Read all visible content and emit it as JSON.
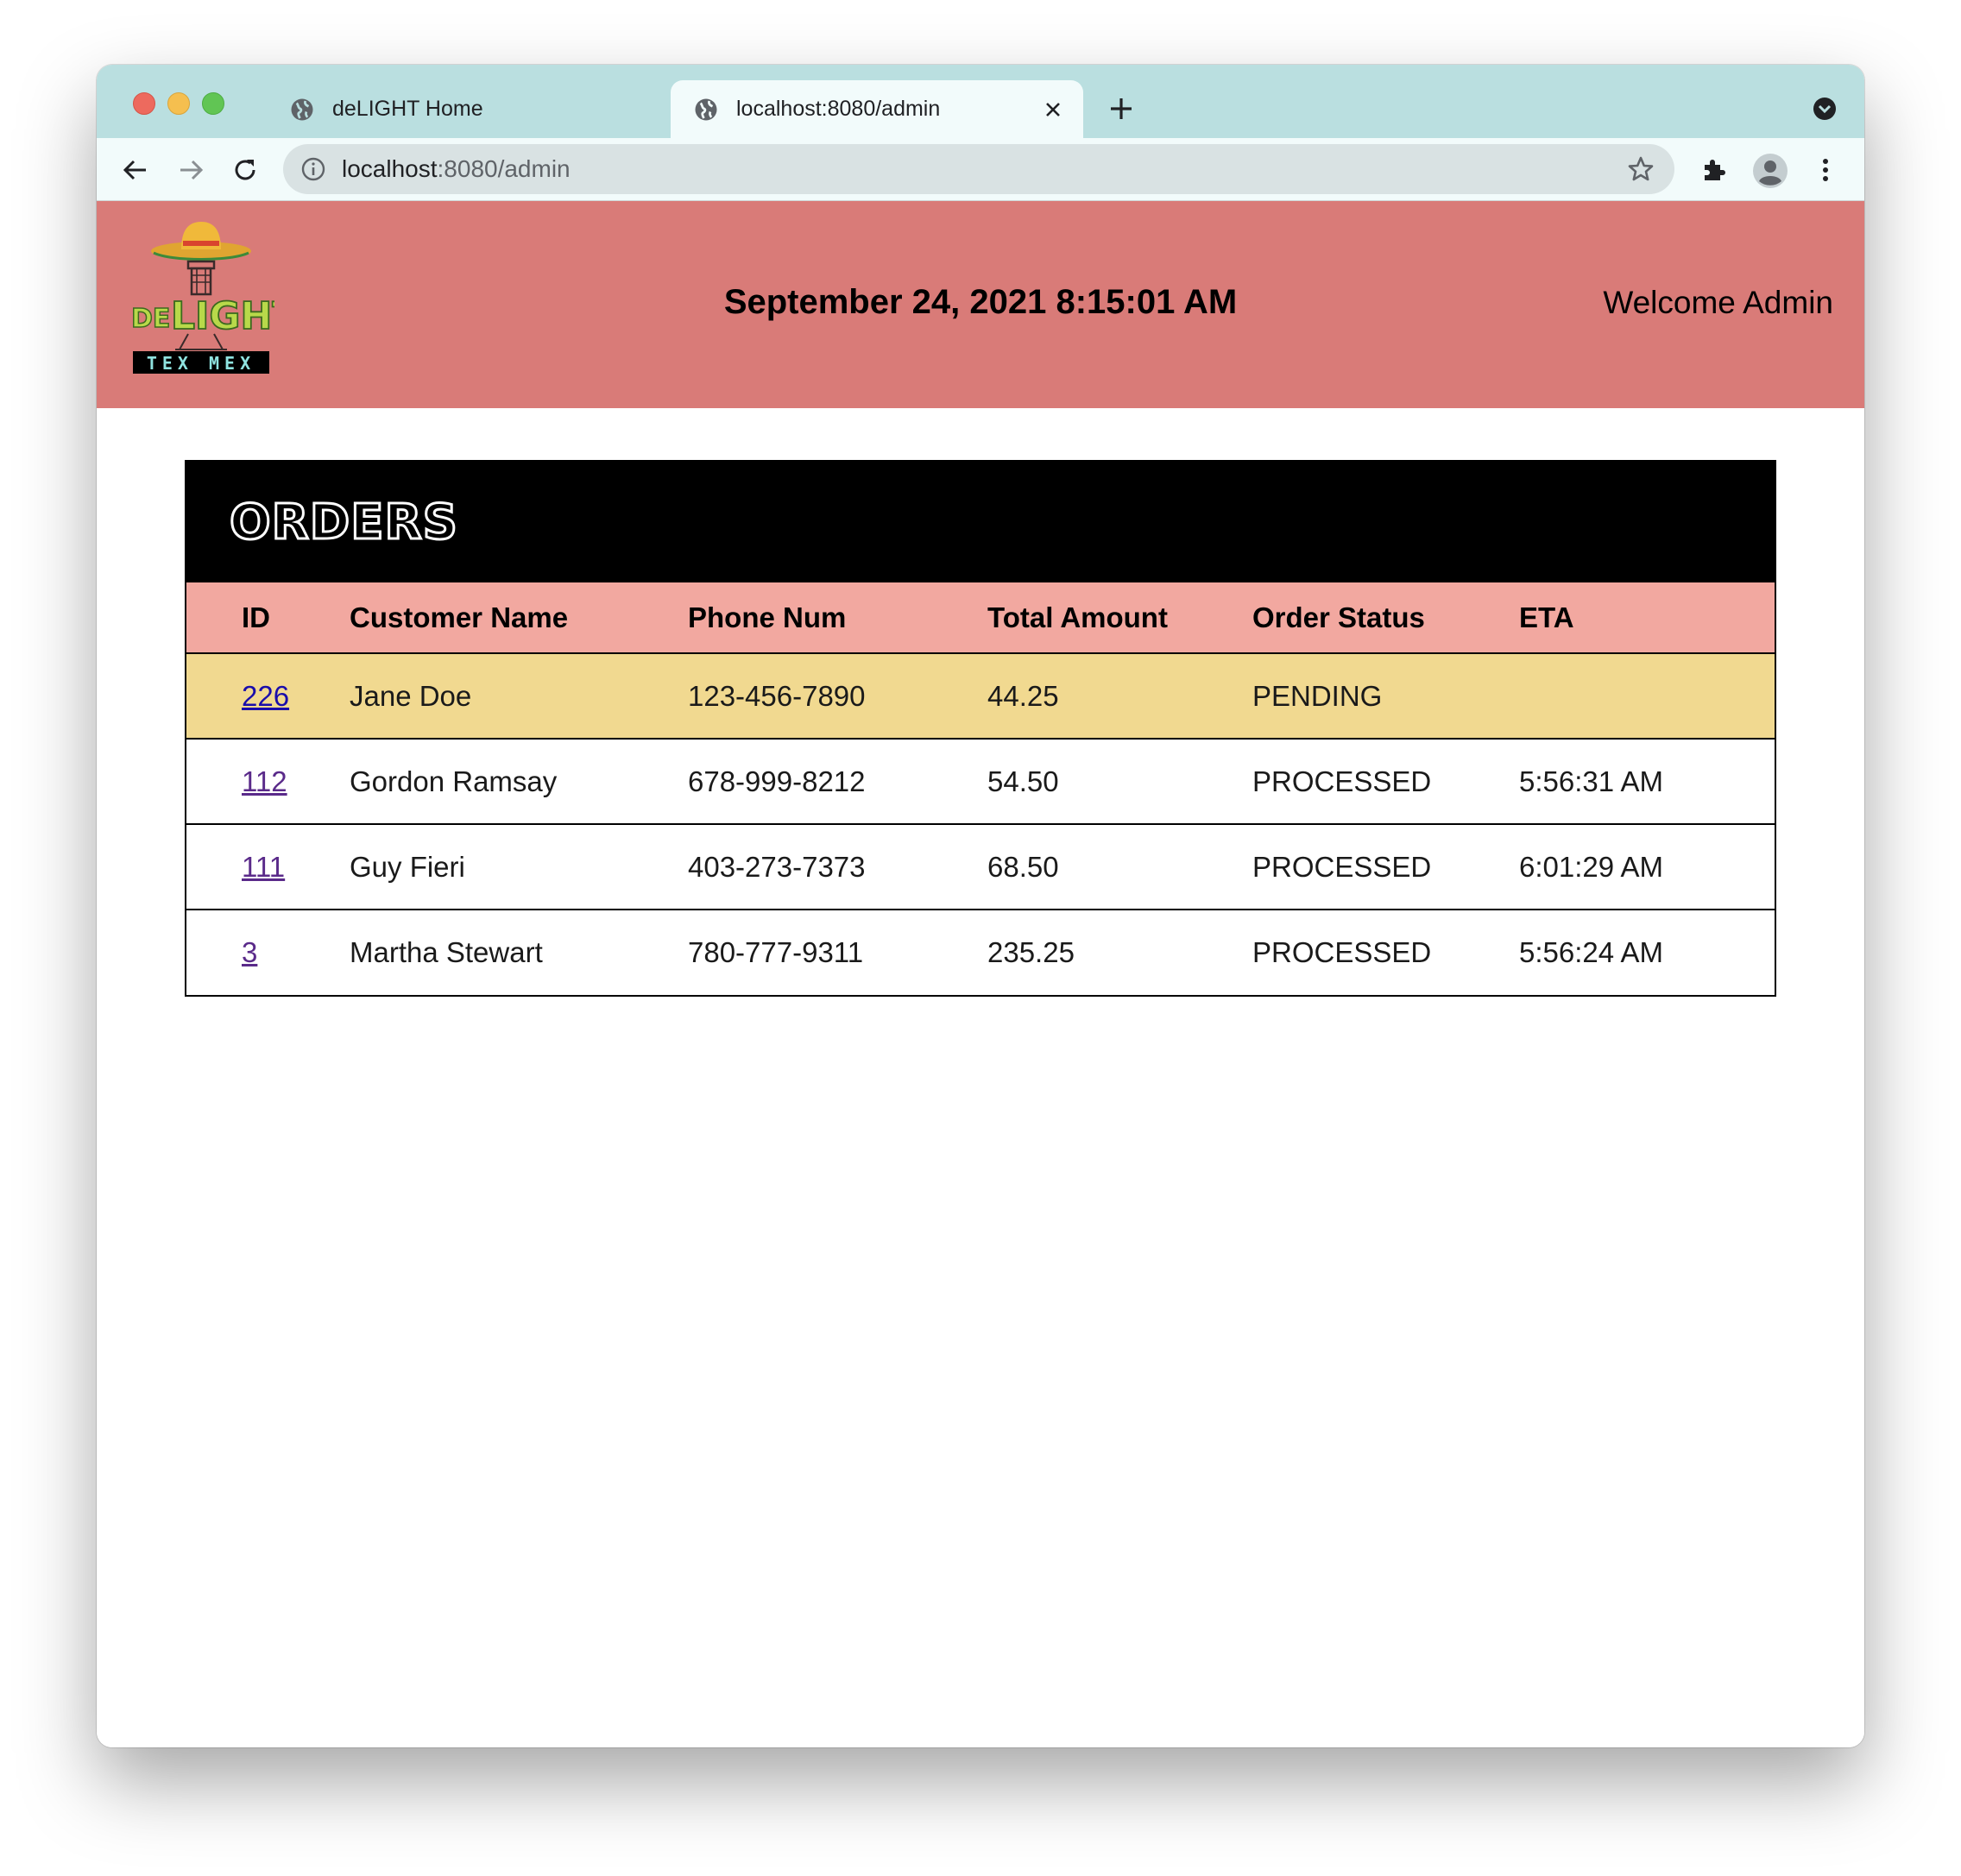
{
  "browser": {
    "tabs": [
      {
        "title": "deLIGHT Home",
        "active": false
      },
      {
        "title": "localhost:8080/admin",
        "active": true
      }
    ],
    "url_host": "localhost",
    "url_path": ":8080/admin"
  },
  "header": {
    "logo_text_top": "DELIGHT",
    "logo_text_bottom": "TEX MEX",
    "datetime": "September 24, 2021 8:15:01 AM",
    "welcome": "Welcome Admin"
  },
  "orders": {
    "title": "ORDERS",
    "columns": [
      "ID",
      "Customer Name",
      "Phone Num",
      "Total Amount",
      "Order Status",
      "ETA"
    ],
    "rows": [
      {
        "id": "226",
        "name": "Jane Doe",
        "phone": "123-456-7890",
        "total": "44.25",
        "status": "PENDING",
        "eta": ""
      },
      {
        "id": "112",
        "name": "Gordon Ramsay",
        "phone": "678-999-8212",
        "total": "54.50",
        "status": "PROCESSED",
        "eta": "5:56:31 AM"
      },
      {
        "id": "111",
        "name": "Guy Fieri",
        "phone": "403-273-7373",
        "total": "68.50",
        "status": "PROCESSED",
        "eta": "6:01:29 AM"
      },
      {
        "id": "3",
        "name": "Martha Stewart",
        "phone": "780-777-9311",
        "total": "235.25",
        "status": "PROCESSED",
        "eta": "5:56:24 AM"
      }
    ]
  },
  "colors": {
    "header_bg": "#d97b78",
    "table_header_bg": "#f2a8a0",
    "pending_row_bg": "#f1d990",
    "tabstrip_bg": "#badfe0"
  }
}
